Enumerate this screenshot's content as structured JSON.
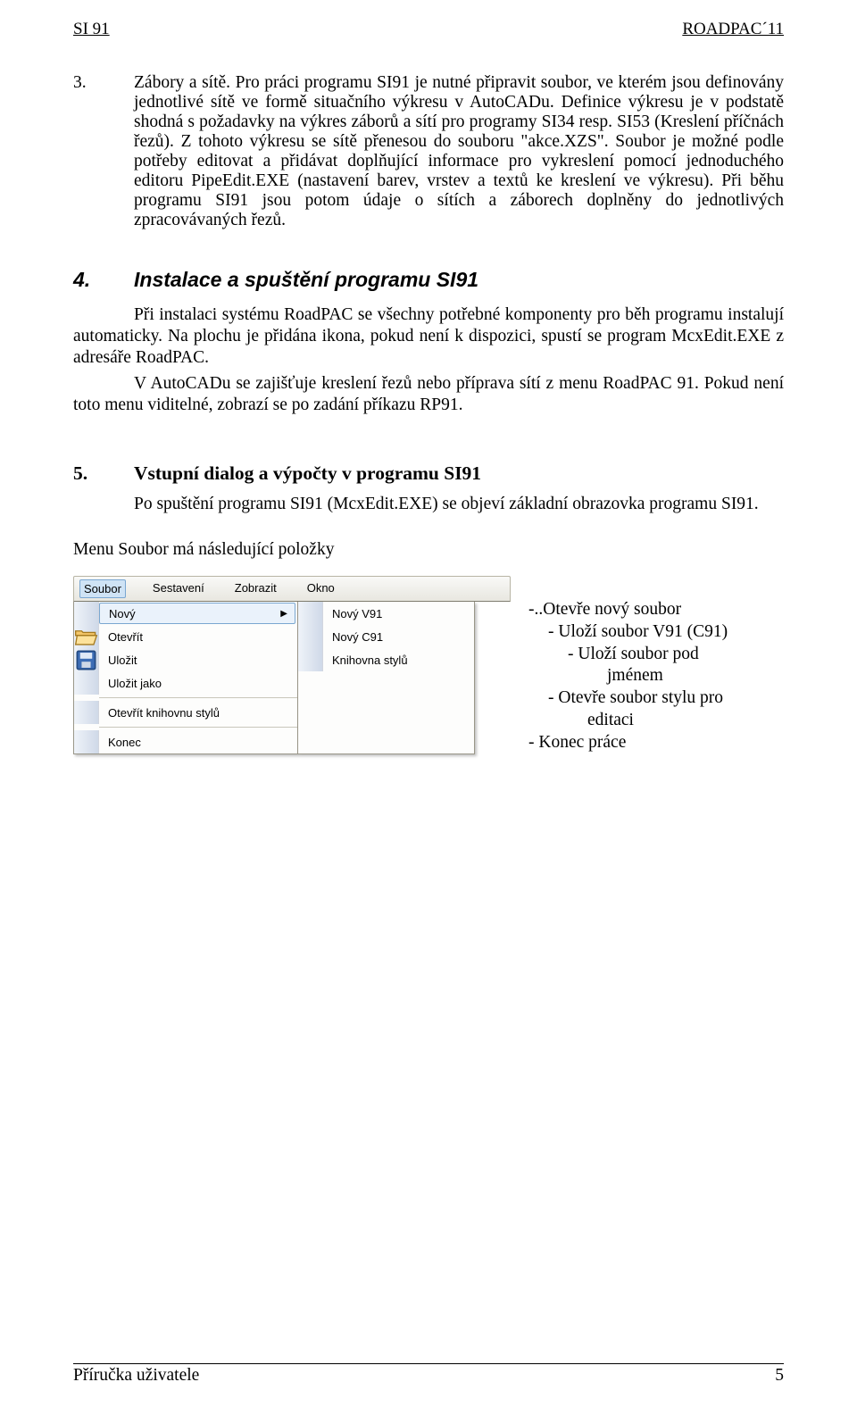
{
  "header": {
    "left": "SI 91",
    "right": "ROADPAC´11"
  },
  "section3": {
    "num": "3.",
    "para1": "Zábory a sítě. Pro práci programu SI91 je nutné připravit soubor, ve kterém jsou definovány jednotlivé sítě ve formě situačního výkresu v AutoCADu. Definice výkresu je v podstatě shodná s požadavky na výkres záborů a sítí pro programy SI34 resp. SI53 (Kreslení příčnách řezů). Z tohoto výkresu se sítě přenesou do souboru \"akce.XZS\". Soubor je možné podle potřeby editovat a přidávat doplňující informace pro vykreslení pomocí jednoduchého editoru PipeEdit.EXE (nastavení barev, vrstev a textů ke kreslení  ve výkresu). Při běhu programu SI91 jsou potom údaje o sítích a záborech doplněny do jednotlivých zpracovávaných řezů."
  },
  "section4": {
    "num": "4.",
    "title": "Instalace a spuštění programu SI91",
    "p1": "Při instalaci systému RoadPAC se všechny potřebné komponenty pro běh programu instalují automaticky. Na plochu je přidána ikona, pokud není k dispozici, spustí se program McxEdit.EXE z adresáře RoadPAC.",
    "p2": "V AutoCADu se zajišťuje kreslení řezů nebo příprava sítí z menu RoadPAC 91. Pokud není toto menu viditelné, zobrazí se po zadání příkazu RP91."
  },
  "section5": {
    "num": "5.",
    "title": "Vstupní dialog a výpočty v programu SI91",
    "p1": "Po spuštění programu SI91 (McxEdit.EXE) se objeví základní obrazovka programu SI91."
  },
  "menuCaption": "Menu  Soubor má následující položky",
  "menubar": [
    "Soubor",
    "Sestavení",
    "Zobrazit",
    "Okno"
  ],
  "leftMenu": {
    "novy": "Nový",
    "otevrit": "Otevřít",
    "ulozit": "Uložit",
    "ulozitJako": "Uložit jako",
    "otevritKnihovnu": "Otevřít knihovnu stylů",
    "konec": "Konec"
  },
  "rightMenu": {
    "novyV91": "Nový V91",
    "novyC91": "Nový C91",
    "knihovnaStylu": "Knihovna stylů"
  },
  "notes": {
    "n1": "-..Otevře nový soubor",
    "n2": "-  Uloží soubor V91 (C91)",
    "n3": "-  Uloží soubor pod",
    "n3b": "jménem",
    "n4": "-  Otevře soubor stylu pro",
    "n4b": "editaci",
    "n5": "-  Konec práce"
  },
  "footer": {
    "left": "Příručka uživatele",
    "right": "5"
  }
}
